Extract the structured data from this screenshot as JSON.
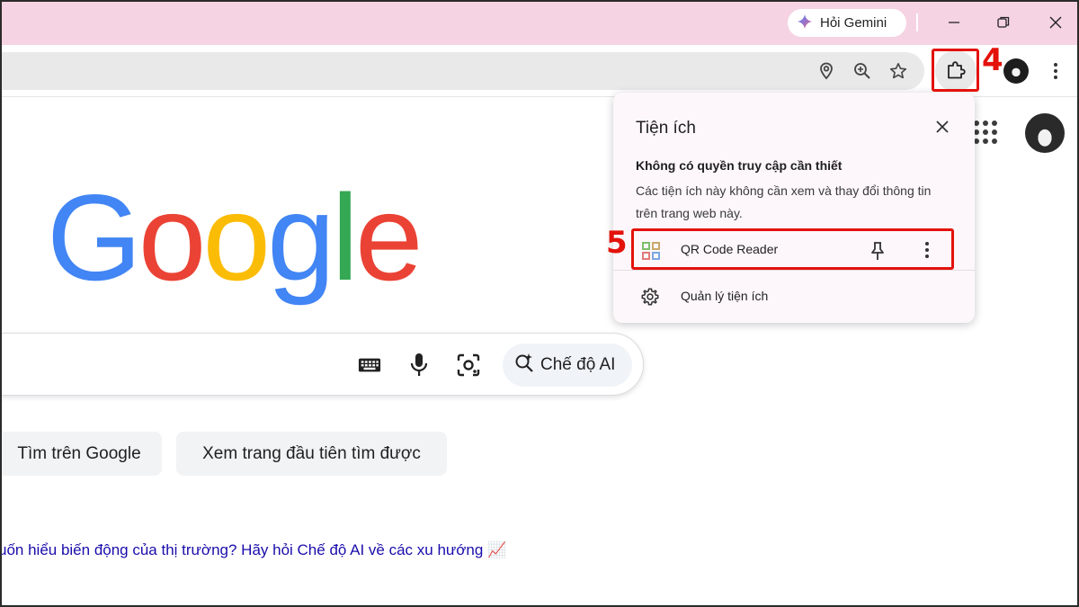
{
  "titlebar": {
    "gemini_label": "Hỏi Gemini",
    "controls": [
      "minimize-icon",
      "restore-icon",
      "close-icon"
    ]
  },
  "toolbar": {
    "omnibox_icons": [
      "location-pin-icon",
      "zoom-icon",
      "star-icon"
    ],
    "extensions_icon": "puzzle-icon",
    "menu_icon": "kebab-menu-icon"
  },
  "callouts": {
    "step4": "4",
    "step5": "5",
    "color": "#e3120b"
  },
  "google": {
    "logo_letters": [
      "G",
      "o",
      "o",
      "g",
      "l",
      "e"
    ],
    "logo_colors": [
      "#4285f4",
      "#ea4335",
      "#fbbc05",
      "#4285f4",
      "#34a853",
      "#ea4335"
    ],
    "search_icons": [
      "keyboard-icon",
      "microphone-icon",
      "camera-lens-icon"
    ],
    "ai_mode_label": "Chế độ AI",
    "buttons": [
      "Tìm trên Google",
      "Xem trang đầu tiên tìm được"
    ],
    "promo_text": "uốn hiểu biến động của thị trường? Hãy hỏi Chế độ AI về các xu hướng 📈"
  },
  "extensions_popup": {
    "title": "Tiện ích",
    "subtitle": "Không có quyền truy cập cần thiết",
    "description": "Các tiện ích này không cần xem và thay đổi thông tin trên trang web này.",
    "items": [
      {
        "name": "QR Code Reader",
        "icon": "qr-code-icon"
      }
    ],
    "manage_label": "Quản lý tiện ích"
  }
}
